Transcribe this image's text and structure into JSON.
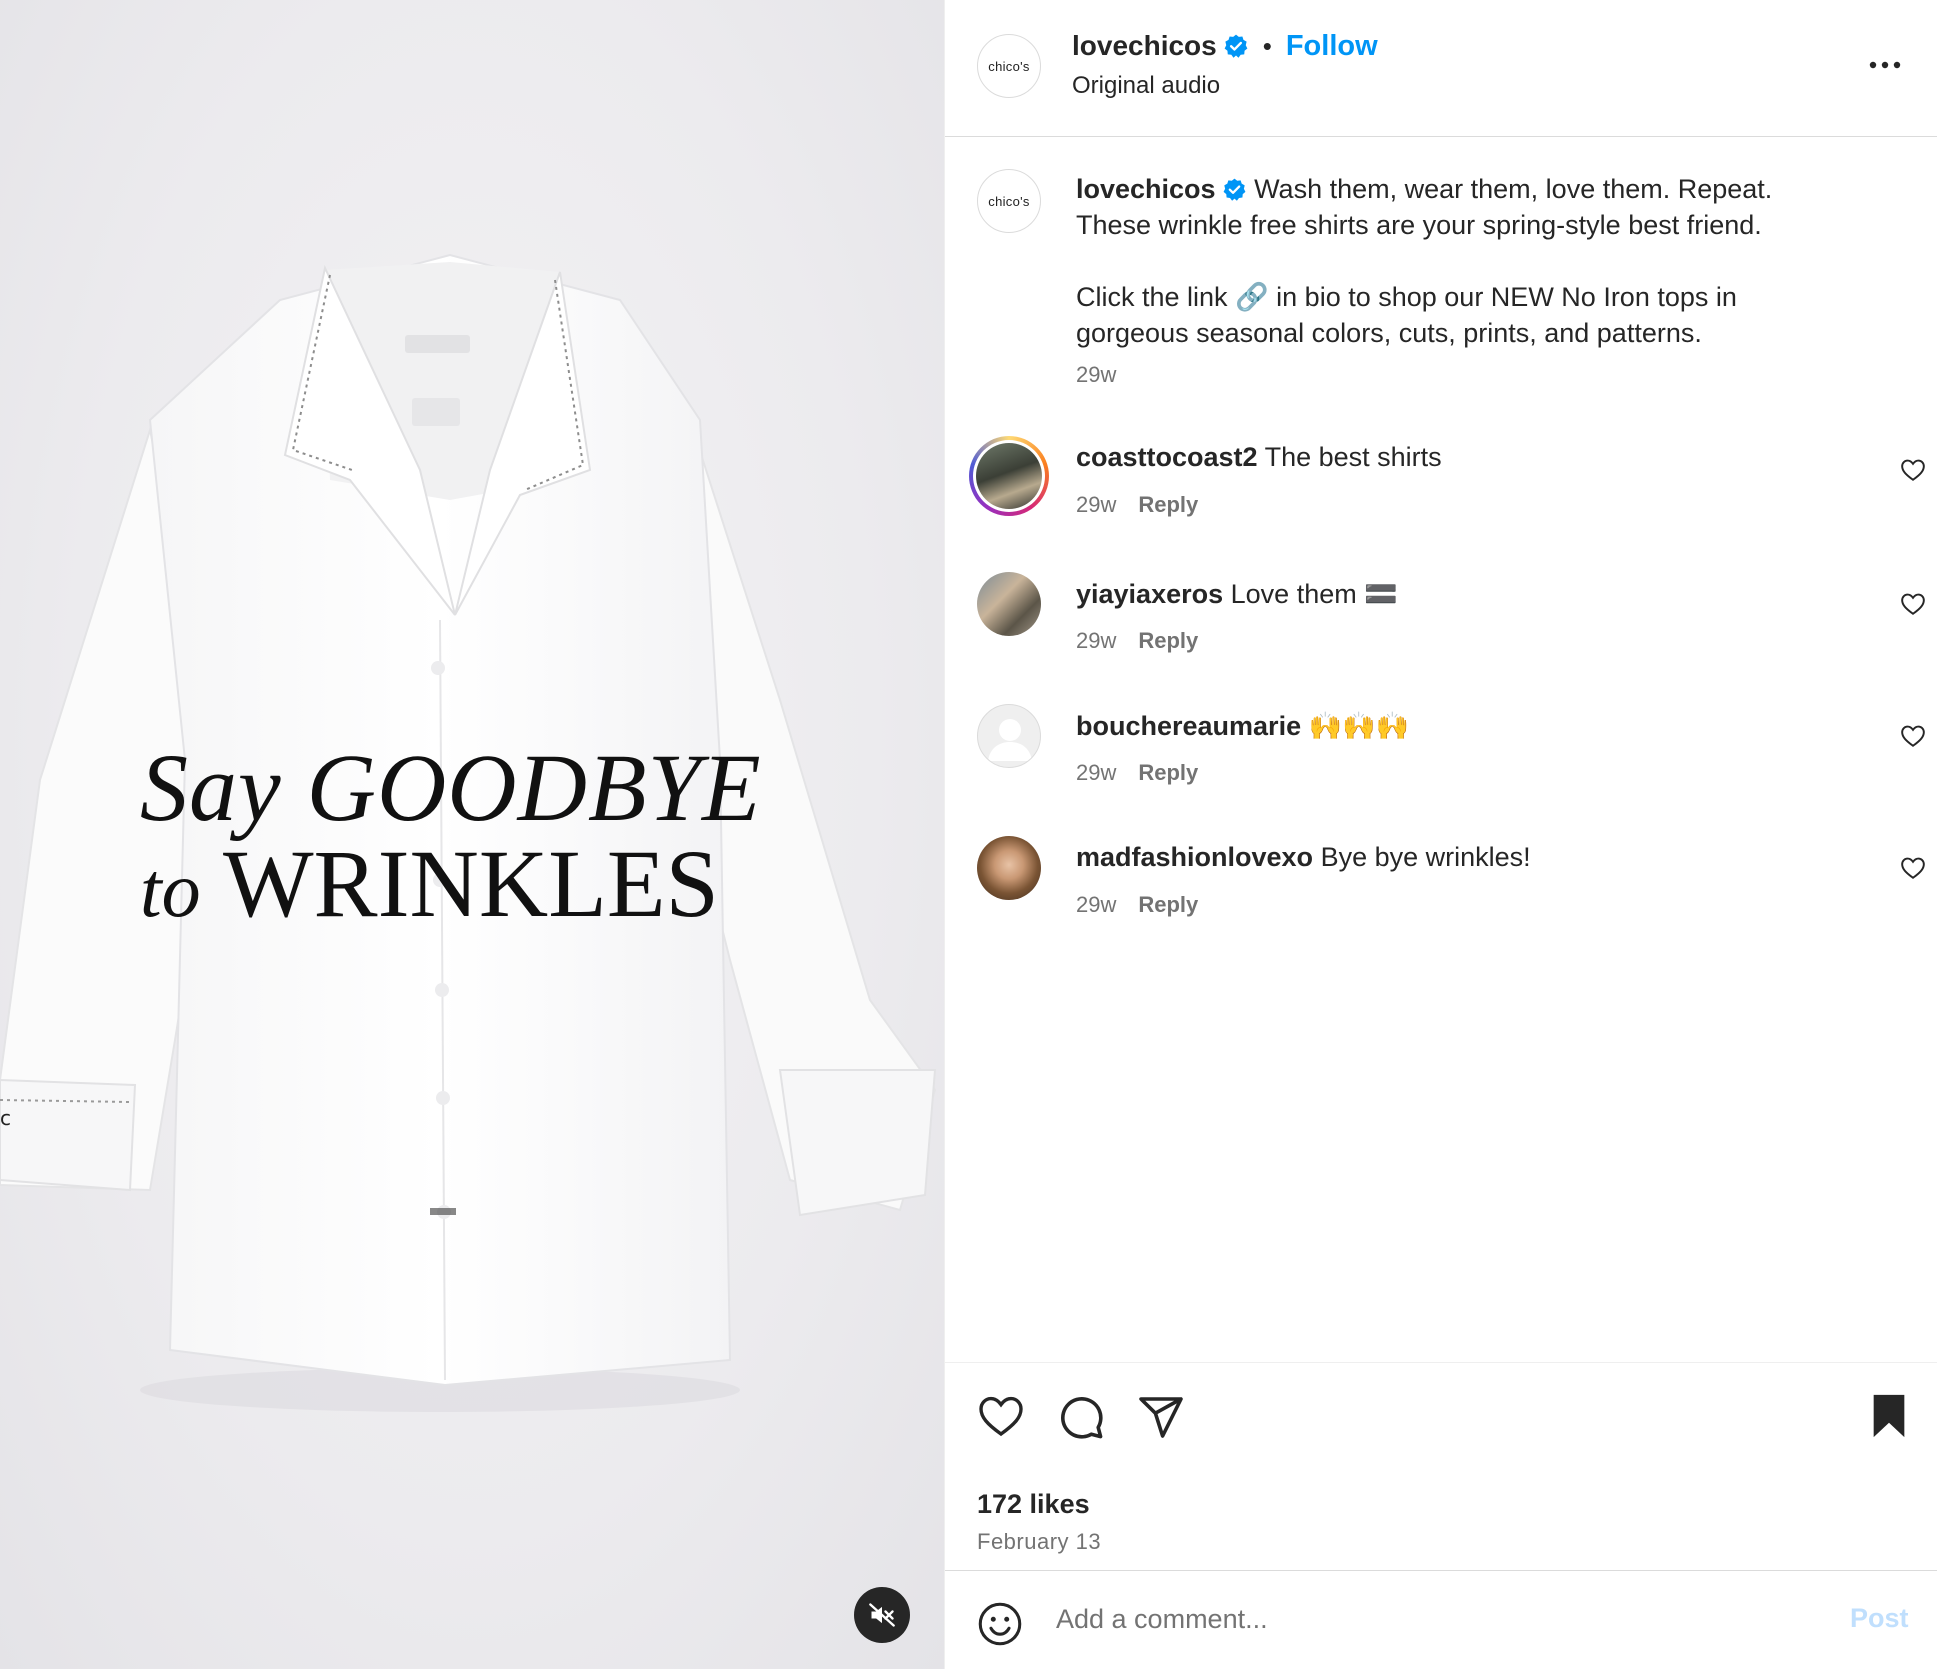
{
  "media": {
    "headline_line1": "Say GOODBYE",
    "headline_line2_small": "to",
    "headline_line2_big": "WRINKLES",
    "mute_icon": "speaker-muted-icon"
  },
  "header": {
    "avatar_text": "chico's",
    "username": "lovechicos",
    "separator": "•",
    "follow_label": "Follow",
    "audio_label": "Original audio"
  },
  "caption": {
    "avatar_text": "chico's",
    "username": "lovechicos",
    "line1": "Wash them, wear them, love them. Repeat.",
    "line2": "These wrinkle free shirts are your spring-style best friend.",
    "line3": "Click the link 🔗 in bio to shop our NEW No Iron tops in",
    "line4": "gorgeous seasonal colors, cuts, prints, and patterns.",
    "time": "29w"
  },
  "comments": [
    {
      "username": "coasttocoast2",
      "text": "The best shirts",
      "time": "29w",
      "reply_label": "Reply"
    },
    {
      "username": "yiayiaxeros",
      "text": "Love them 🟰",
      "time": "29w",
      "reply_label": "Reply"
    },
    {
      "username": "bouchereaumarie",
      "text": "🙌🙌🙌",
      "time": "29w",
      "reply_label": "Reply"
    },
    {
      "username": "madfashionlovexo",
      "text": "Bye bye wrinkles!",
      "time": "29w",
      "reply_label": "Reply"
    }
  ],
  "actions": {
    "likes": "172 likes",
    "date": "February 13"
  },
  "composer": {
    "placeholder": "Add a comment...",
    "post_label": "Post"
  },
  "colors": {
    "accent": "#0095f6",
    "verified": "#0095f6",
    "muted_text": "#737373",
    "post_disabled": "#c0dffd"
  }
}
